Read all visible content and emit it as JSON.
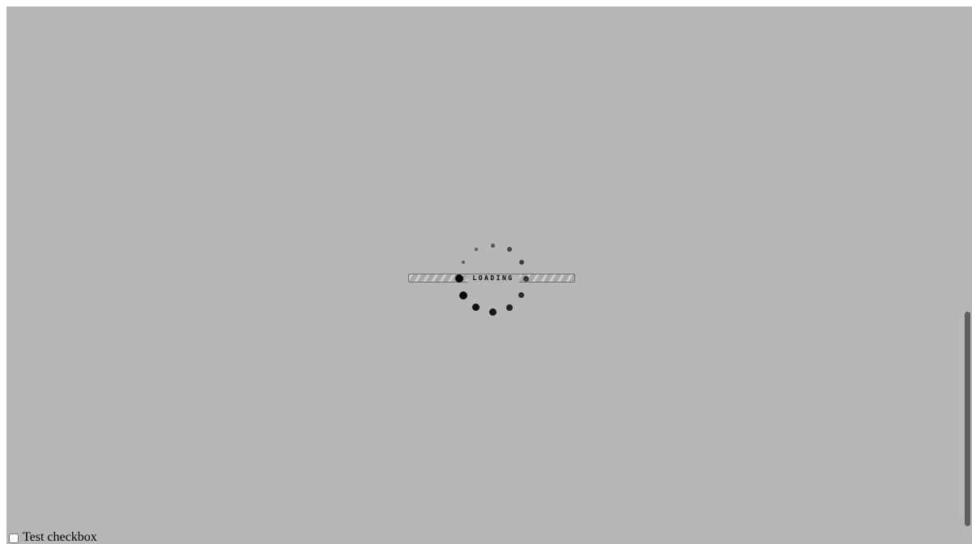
{
  "loading": {
    "label": "LOADING",
    "spinner_dot_count": 12
  },
  "colors": {
    "overlay": "#b7b7b7",
    "spinner": "#000000",
    "bar_base": "#9a9a9a",
    "bar_stripe": "#cfcfcf",
    "scrollbar_thumb": "#5e5e5e"
  },
  "checkbox": {
    "label": "Test checkbox",
    "checked": false
  }
}
